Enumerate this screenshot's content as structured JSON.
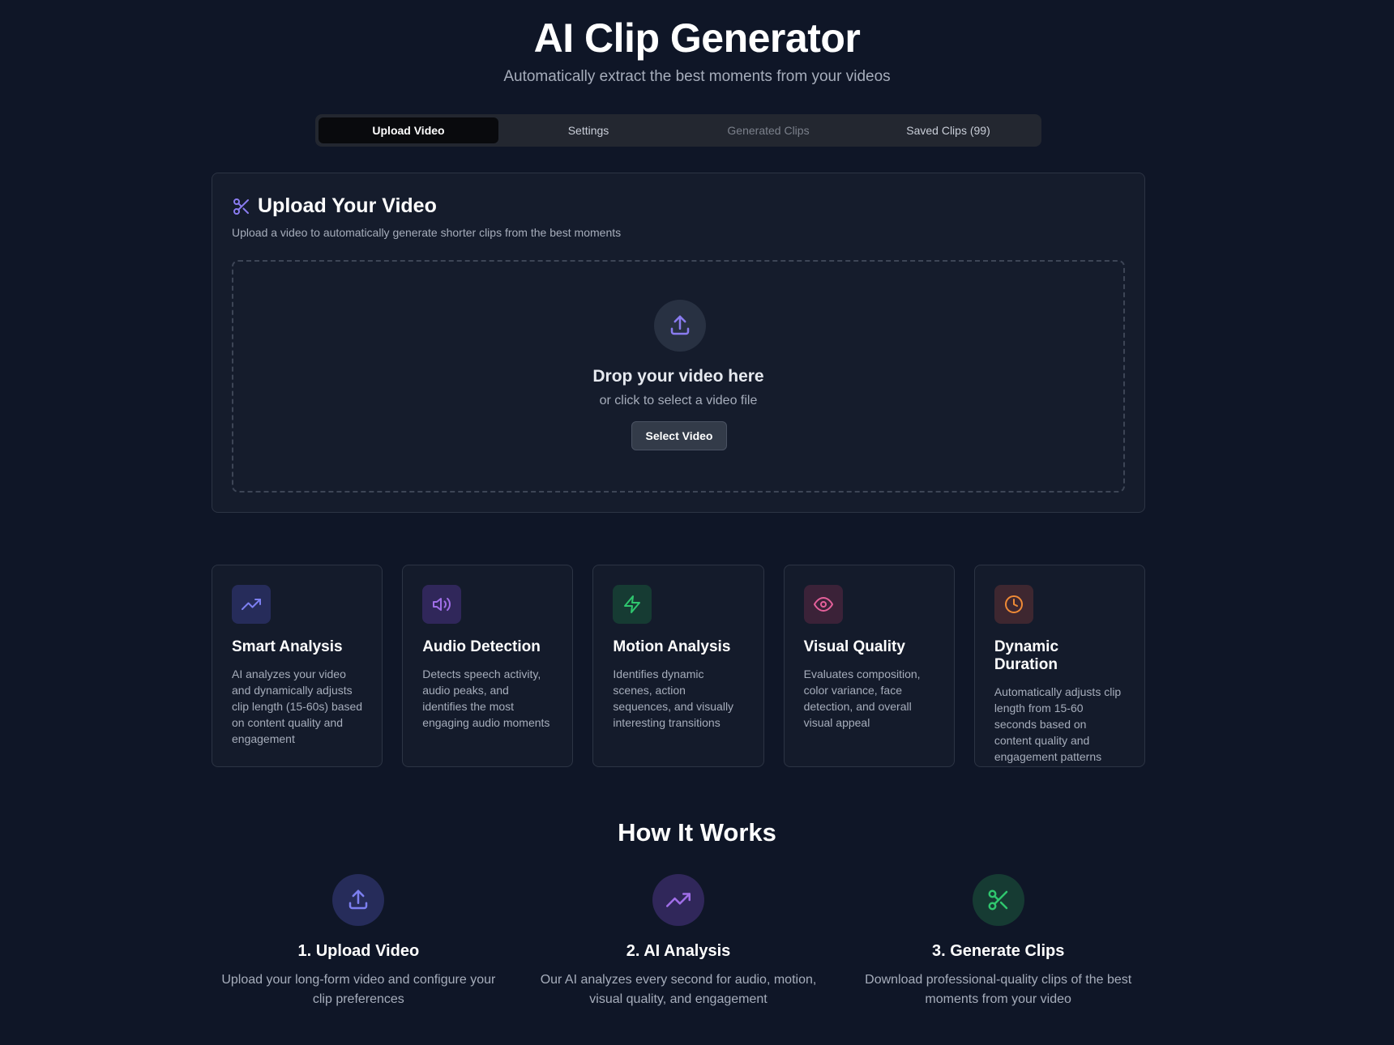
{
  "header": {
    "title": "AI Clip Generator",
    "subtitle": "Automatically extract the best moments from your videos"
  },
  "tabs": [
    {
      "label": "Upload Video",
      "state": "active"
    },
    {
      "label": "Settings",
      "state": "normal"
    },
    {
      "label": "Generated Clips",
      "state": "disabled"
    },
    {
      "label": "Saved Clips (99)",
      "state": "normal"
    }
  ],
  "upload": {
    "icon": "scissors-icon",
    "title": "Upload Your Video",
    "description": "Upload a video to automatically generate shorter clips from the best moments",
    "dropzone": {
      "icon": "upload-icon",
      "title": "Drop your video here",
      "subtitle": "or click to select a video file",
      "button_label": "Select Video"
    }
  },
  "features": [
    {
      "icon": "trending-up-icon",
      "title": "Smart Analysis",
      "description": "AI analyzes your video and dynamically adjusts clip length (15-60s) based on content quality and engagement",
      "color": "#7c7ff0",
      "bg": "#262c5a"
    },
    {
      "icon": "volume-icon",
      "title": "Audio Detection",
      "description": "Detects speech activity, audio peaks, and identifies the most engaging audio moments",
      "color": "#a06ee8",
      "bg": "#30275a"
    },
    {
      "icon": "zap-icon",
      "title": "Motion Analysis",
      "description": "Identifies dynamic scenes, action sequences, and visually interesting transitions",
      "color": "#2fc66e",
      "bg": "#163b33"
    },
    {
      "icon": "eye-icon",
      "title": "Visual Quality",
      "description": "Evaluates composition, color variance, face detection, and overall visual appeal",
      "color": "#e4609a",
      "bg": "#3b2238"
    },
    {
      "icon": "clock-icon",
      "title": "Dynamic Duration",
      "description": "Automatically adjusts clip length from 15-60 seconds based on content quality and engagement patterns",
      "color": "#ef8a36",
      "bg": "#3e2730"
    }
  ],
  "how_it_works": {
    "title": "How It Works",
    "steps": [
      {
        "icon": "upload-icon",
        "title": "1. Upload Video",
        "description": "Upload your long-form video and configure your clip preferences",
        "color": "#7c7ff0",
        "bg": "#262c5a"
      },
      {
        "icon": "trending-up-icon",
        "title": "2. AI Analysis",
        "description": "Our AI analyzes every second for audio, motion, visual quality, and engagement",
        "color": "#a06ee8",
        "bg": "#30275a"
      },
      {
        "icon": "scissors-icon",
        "title": "3. Generate Clips",
        "description": "Download professional-quality clips of the best moments from your video",
        "color": "#2fc66e",
        "bg": "#163b33"
      }
    ]
  }
}
